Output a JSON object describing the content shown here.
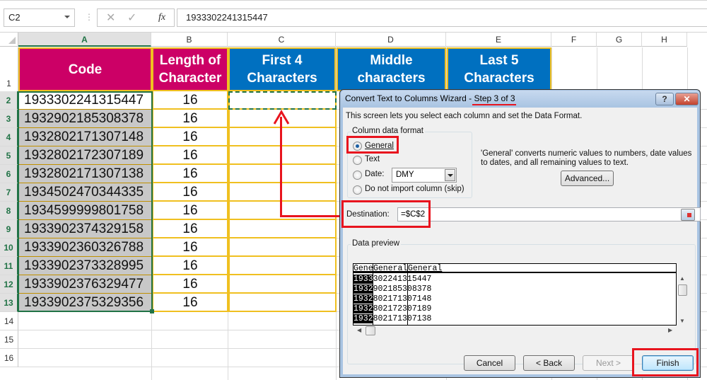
{
  "formula_bar": {
    "name_box": "C2",
    "cancel_icon": "✕",
    "enter_icon": "✓",
    "fx_label": "fx",
    "formula": "1933302241315447"
  },
  "columns": [
    "A",
    "B",
    "C",
    "D",
    "E",
    "F",
    "G",
    "H"
  ],
  "rows": [
    "1",
    "2",
    "3",
    "4",
    "5",
    "6",
    "7",
    "8",
    "9",
    "10",
    "11",
    "12",
    "13",
    "14",
    "15",
    "16"
  ],
  "headers": {
    "a": "Code",
    "b": "Length of Character",
    "c": "First 4 Characters",
    "d": "Middle characters",
    "e": "Last 5 Characters"
  },
  "data_rows": [
    {
      "code": "1933302241315447",
      "length": "16"
    },
    {
      "code": "1932902185308378",
      "length": "16"
    },
    {
      "code": "1932802171307148",
      "length": "16"
    },
    {
      "code": "1932802172307189",
      "length": "16"
    },
    {
      "code": "1932802171307138",
      "length": "16"
    },
    {
      "code": "1934502470344335",
      "length": "16"
    },
    {
      "code": "1934599999801758",
      "length": "16"
    },
    {
      "code": "1933902374329158",
      "length": "16"
    },
    {
      "code": "1933902360326788",
      "length": "16"
    },
    {
      "code": "1933902373328995",
      "length": "16"
    },
    {
      "code": "1933902376329477",
      "length": "16"
    },
    {
      "code": "1933902375329356",
      "length": "16"
    }
  ],
  "dialog": {
    "title_prefix": "Convert Text to Columns Wizard - ",
    "title_step": "Step 3 of 3",
    "help_label": "?",
    "close_label": "✕",
    "intro": "This screen lets you select each column and set the Data Format.",
    "format_group_label": "Column data format",
    "formats": [
      {
        "label": "General",
        "selected": true
      },
      {
        "label": "Text",
        "selected": false
      },
      {
        "label": "Date:",
        "selected": false
      },
      {
        "label": "Do not import column (skip)",
        "selected": false
      }
    ],
    "date_format": "DMY",
    "description_line1": "'General' converts numeric values to numbers, date values",
    "description_line2": "to dates, and all remaining values to text.",
    "advanced_label": "Advanced...",
    "destination_label": "Destination:",
    "destination_value": "=$C$2",
    "preview_label": "Data preview",
    "preview_headers": [
      "Gene",
      "General",
      "General"
    ],
    "preview_rows": [
      [
        "1933",
        "302241",
        "315447"
      ],
      [
        "1932",
        "902185",
        "308378"
      ],
      [
        "1932",
        "802171",
        "307148"
      ],
      [
        "1932",
        "802172",
        "307189"
      ],
      [
        "1932",
        "802171",
        "307138"
      ]
    ],
    "buttons": {
      "cancel": "Cancel",
      "back": "< Back",
      "next": "Next >",
      "finish": "Finish"
    }
  },
  "colors": {
    "header_pink": "#cc0066",
    "header_blue": "#0070c0",
    "annotation_red": "#e8141e",
    "excel_green": "#217346"
  }
}
